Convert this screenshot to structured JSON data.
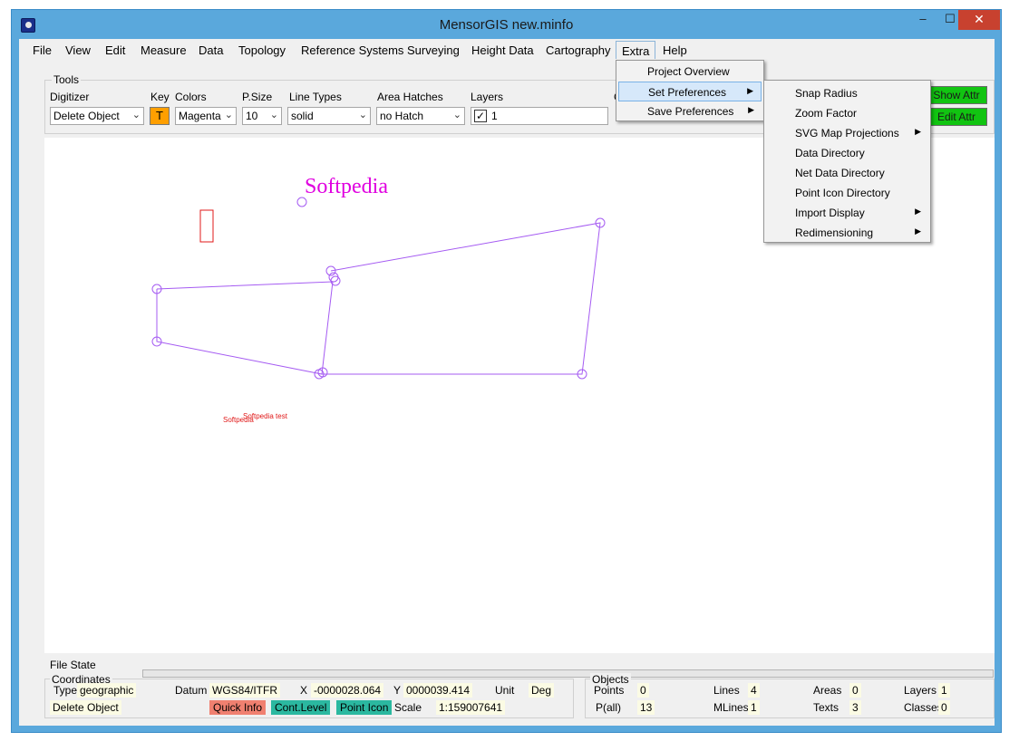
{
  "window": {
    "title": "MensorGIS new.minfo",
    "min": "–",
    "max": "☐",
    "close": "✕"
  },
  "menu": [
    "File",
    "View",
    "Edit",
    "Measure",
    "Data",
    "Topology",
    "Reference Systems",
    "Surveying",
    "Height Data",
    "Cartography",
    "Extra",
    "Help"
  ],
  "tools": {
    "group_label": "Tools",
    "digitizer_label": "Digitizer",
    "digitizer_value": "Delete Object",
    "key_label": "Key",
    "key_value": "T",
    "colors_label": "Colors",
    "colors_value": "Magenta",
    "psize_label": "P.Size",
    "psize_value": "10",
    "linetypes_label": "Line Types",
    "linetypes_value": "solid",
    "hatches_label": "Area Hatches",
    "hatches_value": "no Hatch",
    "layers_label": "Layers",
    "layers_value": "1",
    "cut_label": "C",
    "show_attr": "Show Attr",
    "edit_attr": "Edit Attr"
  },
  "extra_menu": {
    "items": [
      "Project Overview",
      "Set Preferences",
      "Save Preferences"
    ]
  },
  "prefs_submenu": {
    "items": [
      "Snap Radius",
      "Zoom Factor",
      "SVG Map Projections",
      "Data Directory",
      "Net Data Directory",
      "Point Icon Directory",
      "Import Display",
      "Redimensioning"
    ]
  },
  "canvas": {
    "title_text": "Softpedia",
    "label1": "Softpedia",
    "label2": "Softpedia test"
  },
  "status": {
    "file_state": "File State",
    "coords_label": "Coordinates",
    "type_label": "Type",
    "type_value": "geographic",
    "datum_label": "Datum",
    "datum_value": "WGS84/ITFR",
    "x_label": "X",
    "x_value": "-0000028.064",
    "y_label": "Y",
    "y_value": "0000039.414",
    "unit_label": "Unit",
    "unit_value": "Deg",
    "mode_value": "Delete Object",
    "quick_info": "Quick Info",
    "cont_level": "Cont.Level",
    "point_icon": "Point Icon",
    "scale_label": "Scale",
    "scale_value": "1:159007641",
    "objects_label": "Objects",
    "points_label": "Points",
    "points_value": "0",
    "pall_label": "P(all)",
    "pall_value": "13",
    "lines_label": "Lines",
    "lines_value": "4",
    "mlines_label": "MLines",
    "mlines_value": "1",
    "areas_label": "Areas",
    "areas_value": "0",
    "texts_label": "Texts",
    "texts_value": "3",
    "layers_label": "Layers",
    "layers_value": "1",
    "classes_label": "Classes",
    "classes_value": "0"
  },
  "colors": {
    "accent_window": "#5aa8dc",
    "drawing": "#a55bf2",
    "text_magenta": "#e000e0",
    "button_green": "#11c411",
    "key_orange": "#ff9f00"
  }
}
